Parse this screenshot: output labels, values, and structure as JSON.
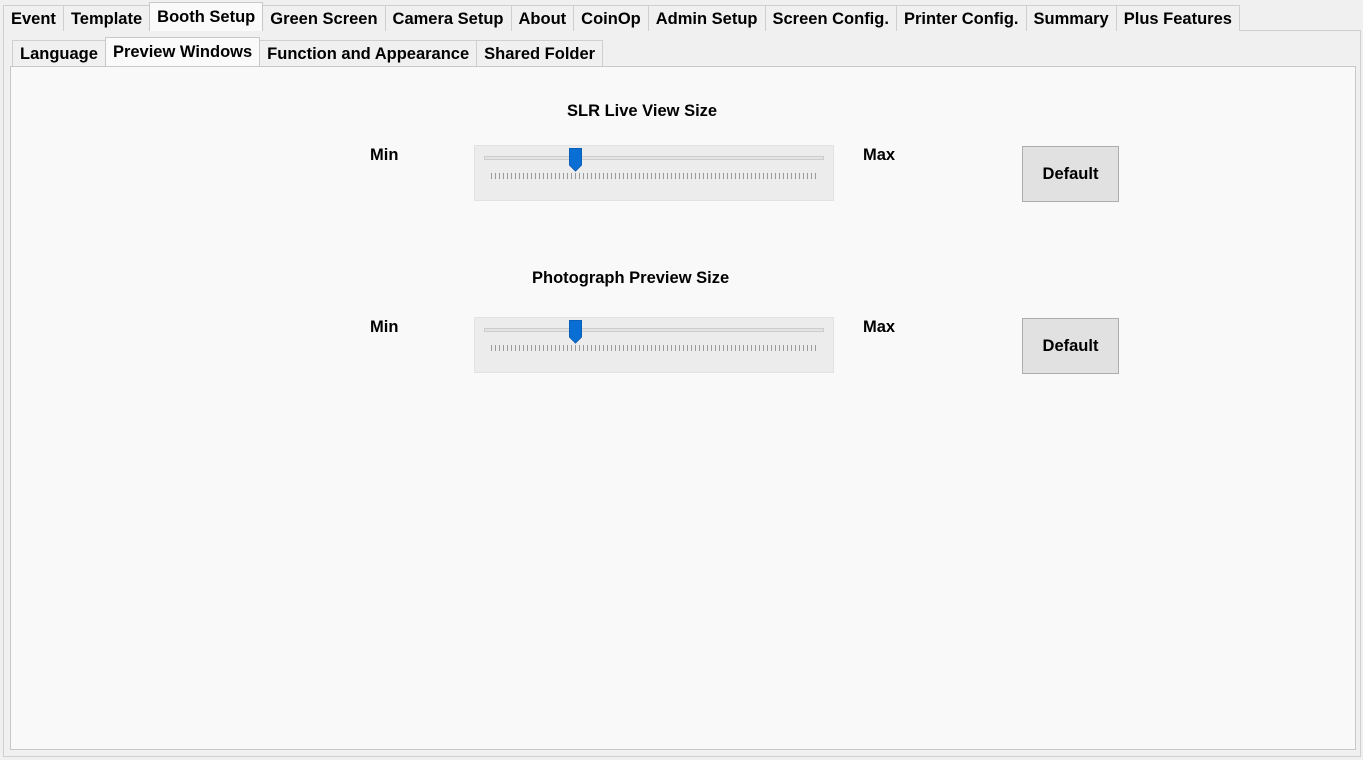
{
  "top_tabs": {
    "items": [
      {
        "label": "Event"
      },
      {
        "label": "Template"
      },
      {
        "label": "Booth Setup",
        "selected": true
      },
      {
        "label": "Green Screen"
      },
      {
        "label": "Camera Setup"
      },
      {
        "label": "About"
      },
      {
        "label": "CoinOp"
      },
      {
        "label": "Admin Setup"
      },
      {
        "label": "Screen Config."
      },
      {
        "label": "Printer Config."
      },
      {
        "label": "Summary"
      },
      {
        "label": "Plus Features"
      }
    ]
  },
  "sub_tabs": {
    "items": [
      {
        "label": "Language"
      },
      {
        "label": "Preview Windows",
        "selected": true
      },
      {
        "label": "Function and Appearance"
      },
      {
        "label": "Shared Folder"
      }
    ]
  },
  "slr_live_view": {
    "title": "SLR Live View Size",
    "min_label": "Min",
    "max_label": "Max",
    "slider_value_fraction": 0.27,
    "default_label": "Default"
  },
  "photo_preview": {
    "title": "Photograph Preview Size",
    "min_label": "Min",
    "max_label": "Max",
    "slider_value_fraction": 0.27,
    "default_label": "Default"
  },
  "colors": {
    "thumb": "#0a6fd4",
    "panel_bg": "#f9f9f9",
    "window_bg": "#f0f0f0"
  }
}
